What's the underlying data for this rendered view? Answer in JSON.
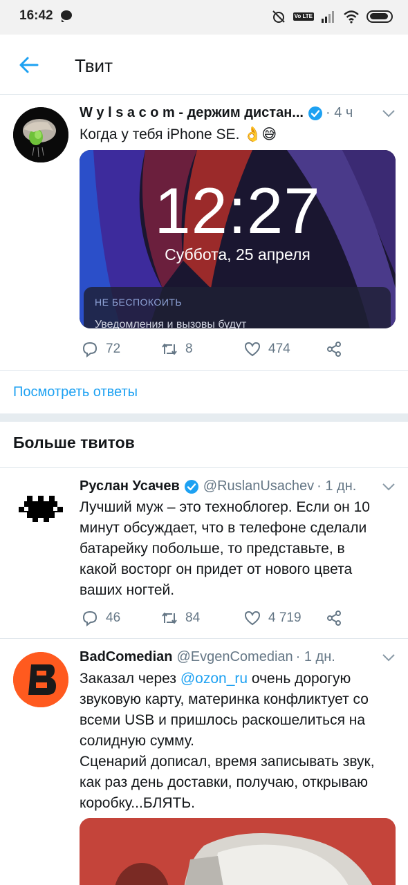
{
  "status_bar": {
    "time": "16:42",
    "lte": "Vo LTE"
  },
  "header": {
    "title": "Твит"
  },
  "main_tweet": {
    "name": "W y l s a c o m - держим дистан...",
    "time": "· 4 ч",
    "text": "Когда у тебя iPhone SE. 👌😅",
    "media": {
      "lock_time": "12:27",
      "lock_date": "Суббота, 25 апреля",
      "dnd_title": "НЕ БЕСПОКОИТЬ",
      "dnd_subtitle": "Уведомления и вызовы будут"
    },
    "replies": "72",
    "retweets": "8",
    "likes": "474"
  },
  "see_replies": "Посмотреть ответы",
  "more_tweets_title": "Больше твитов",
  "tweets": [
    {
      "name": "Руслан Усачев",
      "handle": "@RuslanUsachev",
      "time": "· 1 дн.",
      "lines": [
        "Лучший муж – это техноблогер. Если он 10",
        "минут обсуждает, что в телефоне сделали",
        "батарейку побольше, то представьте, в",
        "какой восторг он придет от нового цвета",
        "ваших ногтей."
      ],
      "replies": "46",
      "retweets": "84",
      "likes": "4 719"
    },
    {
      "name": "BadComedian",
      "handle": "@EvgenComedian",
      "time": "· 1 дн.",
      "line1_pre": "Заказал через ",
      "line1_link": "@ozon_ru",
      "line1_post": " очень дорогую",
      "lines": [
        "звуковую карту, материнка конфликтует со",
        "всеми USB и пришлось раскошелиться на",
        "солидную сумму.",
        "Сценарий дописал, время записывать звук,",
        "как раз день доставки, получаю, открываю",
        "коробку...БЛЯТЬ."
      ]
    }
  ],
  "colors": {
    "accent": "#1da1f2",
    "text": "#14171a",
    "secondary": "#657786",
    "divider": "#e1e8ed"
  }
}
